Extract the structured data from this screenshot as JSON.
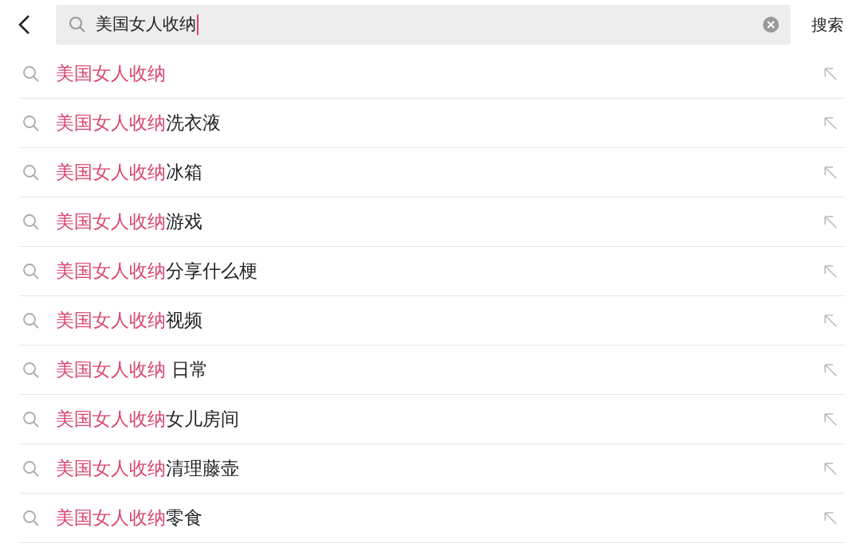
{
  "search_bar": {
    "query": "美国女人收纳",
    "submit": "搜索"
  },
  "suggestions": [
    {
      "match": "美国女人收纳"
    },
    {
      "match": "美国女人收纳",
      "rest": "洗衣液"
    },
    {
      "match": "美国女人收纳",
      "rest": "冰箱"
    },
    {
      "match": "美国女人收纳",
      "rest": "游戏"
    },
    {
      "match": "美国女人收纳",
      "rest": "分享什么梗"
    },
    {
      "match": "美国女人收纳",
      "rest": "视频"
    },
    {
      "match": "美国女人收纳",
      "rest": " 日常"
    },
    {
      "match": "美国女人收纳",
      "rest": "女儿房间"
    },
    {
      "match": "美国女人收纳",
      "rest": "清理藤壶"
    },
    {
      "match": "美国女人收纳",
      "rest": "零食"
    }
  ]
}
